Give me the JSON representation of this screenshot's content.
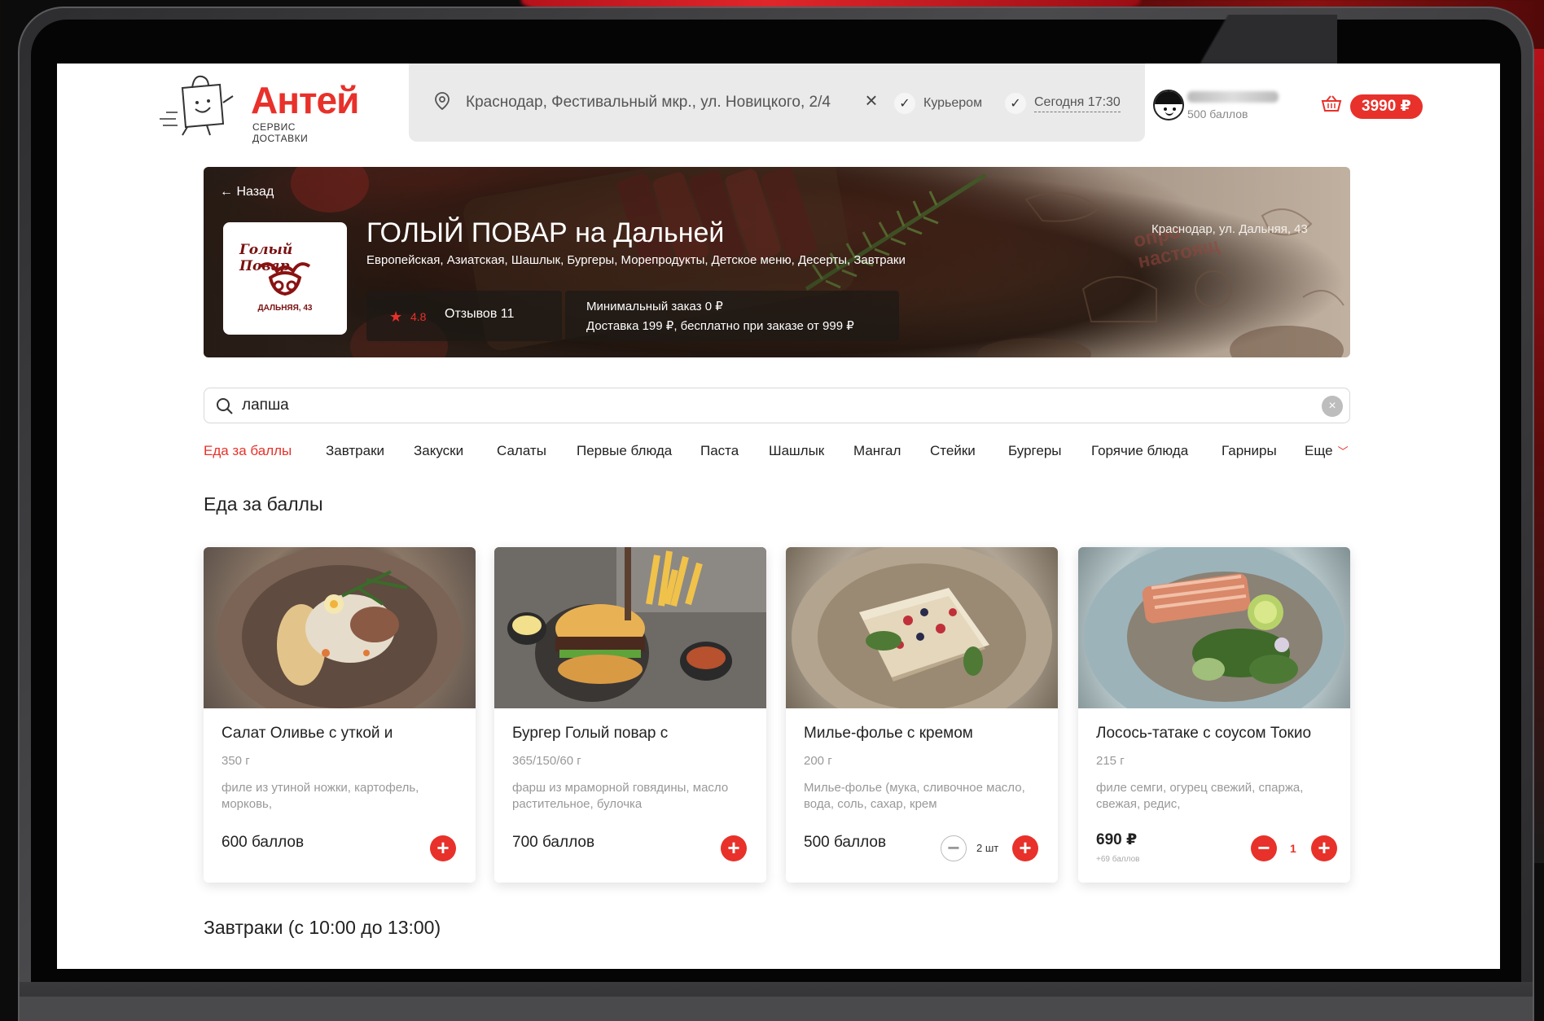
{
  "brand": {
    "name": "Антей",
    "subtitle": "СЕРВИС ДОСТАВКИ",
    "accent": "#e8312a"
  },
  "header": {
    "address": "Краснодар, Фестивальный мкр., ул. Новицкого, 2/4",
    "delivery_mode": "Курьером",
    "delivery_time": "Сегодня 17:30",
    "user_points": "500 баллов",
    "cart_total": "3990 ₽"
  },
  "restaurant": {
    "back_label": "← Назад",
    "title": "ГОЛЫЙ ПОВАР на Дальней",
    "cuisines": "Европейская, Азиатская, Шашлык, Бургеры, Морепродукты, Детское меню, Десерты, Завтраки",
    "address": "Краснодар, ул. Дальняя, 43",
    "rating": "4.8",
    "reviews": "Отзывов 11",
    "min_order": "Минимальный заказ 0 ₽",
    "delivery_info": "Доставка 199 ₽, бесплатно при заказе от 999 ₽",
    "logo_script": "Голый Повар",
    "logo_caption": "ДАЛЬНЯЯ, 43",
    "paper_text": "опро\nнастоящ"
  },
  "search": {
    "value": "лапша",
    "clear_icon": "clear-icon"
  },
  "categories": [
    "Еда за баллы",
    "Завтраки",
    "Закуски",
    "Салаты",
    "Первые блюда",
    "Паста",
    "Шашлык",
    "Мангал",
    "Стейки",
    "Бургеры",
    "Горячие блюда",
    "Гарниры",
    "Еще"
  ],
  "active_category": "Еда за баллы",
  "sections": {
    "points_title": "Еда за баллы",
    "breakfast_title": "Завтраки (с 10:00 до 13:00)"
  },
  "cards": [
    {
      "name": "Салат Оливье с уткой и",
      "weight": "350 г",
      "desc": "филе из утиной ножки, картофель, морковь,",
      "price": "600 баллов"
    },
    {
      "name": "Бургер Голый повар с",
      "weight": "365/150/60 г",
      "desc": "фарш из мраморной говядины, масло растительное, булочка",
      "price": "700 баллов"
    },
    {
      "name": "Милье-фолье с кремом",
      "weight": "200 г",
      "desc": "Мильe-фолье (мука, сливочное масло, вода, соль, сахар, крем",
      "price": "500 баллов",
      "qty": "2 шт"
    },
    {
      "name": "Лосось-татаке с соусом Токио",
      "weight": "215 г",
      "desc": "филе семги, огурец свежий, спаржа, свежая, редис,",
      "price": "690 ₽",
      "subprice": "+69 баллов",
      "qty": "1"
    }
  ]
}
